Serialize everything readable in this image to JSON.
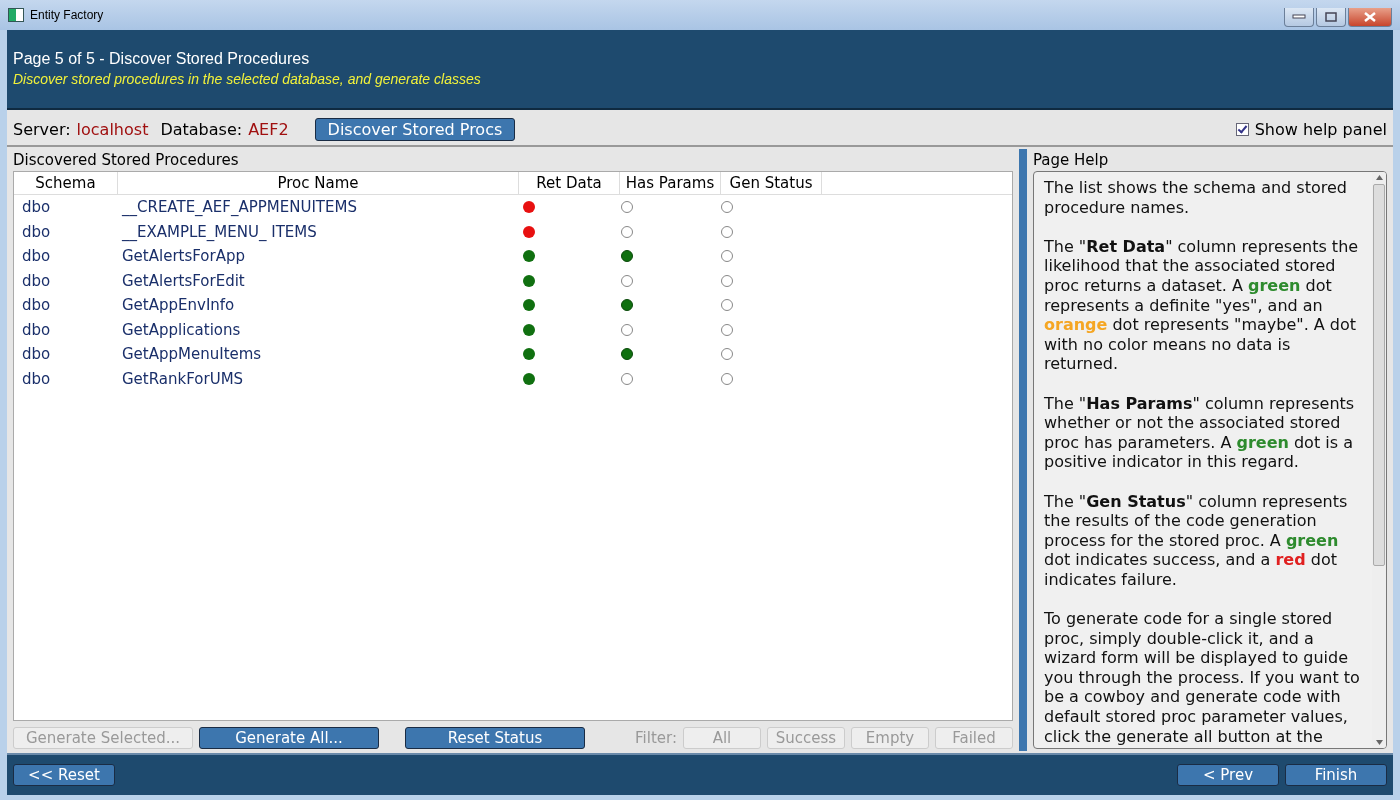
{
  "window": {
    "title": "Entity Factory"
  },
  "header": {
    "title": "Page 5 of 5 - Discover Stored Procedures",
    "subtitle": "Discover stored procedures in the selected database, and generate classes"
  },
  "toolbar": {
    "server_label": "Server:",
    "server": "localhost",
    "database_label": "Database:",
    "database": "AEF2",
    "discover_button": "Discover Stored Procs",
    "show_help": {
      "label": "Show help panel",
      "checked": true
    }
  },
  "list": {
    "title": "Discovered Stored Procedures",
    "columns": [
      "Schema",
      "Proc Name",
      "Ret Data",
      "Has Params",
      "Gen Status"
    ],
    "rows": [
      {
        "schema": "dbo",
        "name": "__CREATE_AEF_APPMENUITEMS",
        "ret_data": {
          "color": "#e81010"
        },
        "has_params": false,
        "generated": false
      },
      {
        "schema": "dbo",
        "name": "__EXAMPLE_MENU_ ITEMS",
        "ret_data": {
          "color": "#e81010"
        },
        "has_params": false,
        "generated": false
      },
      {
        "schema": "dbo",
        "name": "GetAlertsForApp",
        "ret_data": {
          "color": "#107010"
        },
        "has_params": true,
        "generated": false
      },
      {
        "schema": "dbo",
        "name": "GetAlertsForEdit",
        "ret_data": {
          "color": "#107010"
        },
        "has_params": false,
        "generated": false
      },
      {
        "schema": "dbo",
        "name": "GetAppEnvInfo",
        "ret_data": {
          "color": "#107010"
        },
        "has_params": true,
        "generated": false
      },
      {
        "schema": "dbo",
        "name": "GetApplications",
        "ret_data": {
          "color": "#107010"
        },
        "has_params": false,
        "generated": false
      },
      {
        "schema": "dbo",
        "name": "GetAppMenuItems",
        "ret_data": {
          "color": "#107010"
        },
        "has_params": true,
        "generated": false
      },
      {
        "schema": "dbo",
        "name": "GetRankForUMS",
        "ret_data": {
          "color": "#107010"
        },
        "has_params": false,
        "generated": false
      }
    ]
  },
  "actions": [
    {
      "label": "Generate Selected...",
      "disabled": true
    },
    {
      "label": "Generate All...",
      "disabled": false
    },
    {
      "label": "Reset Status",
      "disabled": false
    }
  ],
  "filter": {
    "label": "Filter:",
    "buttons": [
      {
        "label": "All",
        "disabled": true
      },
      {
        "label": "Success",
        "disabled": true
      },
      {
        "label": "Empty",
        "disabled": true
      },
      {
        "label": "Failed",
        "disabled": true
      }
    ]
  },
  "help": {
    "title": "Page Help",
    "paragraphs": [
      [
        {
          "text": "The list shows the schema and stored procedure names."
        }
      ],
      [
        {
          "text": "The \""
        },
        {
          "text": "Ret Data",
          "bold": true
        },
        {
          "text": "\" column represents the likelihood that the associated stored proc returns a dataset. A "
        },
        {
          "text": "green",
          "bold": true,
          "color": "#2e8b2e"
        },
        {
          "text": " dot represents a definite \"yes\", and an "
        },
        {
          "text": "orange",
          "bold": true,
          "color": "#f5a623"
        },
        {
          "text": " dot represents \"maybe\". A dot with no color means no data is returned."
        }
      ],
      [
        {
          "text": "The \""
        },
        {
          "text": "Has Params",
          "bold": true
        },
        {
          "text": "\" column represents whether or not the associated stored proc has parameters. A "
        },
        {
          "text": "green",
          "bold": true,
          "color": "#2e8b2e"
        },
        {
          "text": " dot is a positive indicator in this regard."
        }
      ],
      [
        {
          "text": "The \""
        },
        {
          "text": "Gen Status",
          "bold": true
        },
        {
          "text": "\" column represents the results of the code generation process for the stored proc. A "
        },
        {
          "text": "green",
          "bold": true,
          "color": "#2e8b2e"
        },
        {
          "text": " dot indicates success, and a "
        },
        {
          "text": "red",
          "bold": true,
          "color": "#e02020"
        },
        {
          "text": " dot indicates failure."
        }
      ],
      [
        {
          "text": "To generate code for a single stored proc, simply double-click it, and a wizard form will be displayed to guide you through the process. If you want to be a cowboy and generate code with default stored proc parameter values, click the generate all button at the"
        }
      ]
    ]
  },
  "footer": {
    "reset": "<< Reset",
    "prev": "< Prev",
    "finish": "Finish"
  }
}
